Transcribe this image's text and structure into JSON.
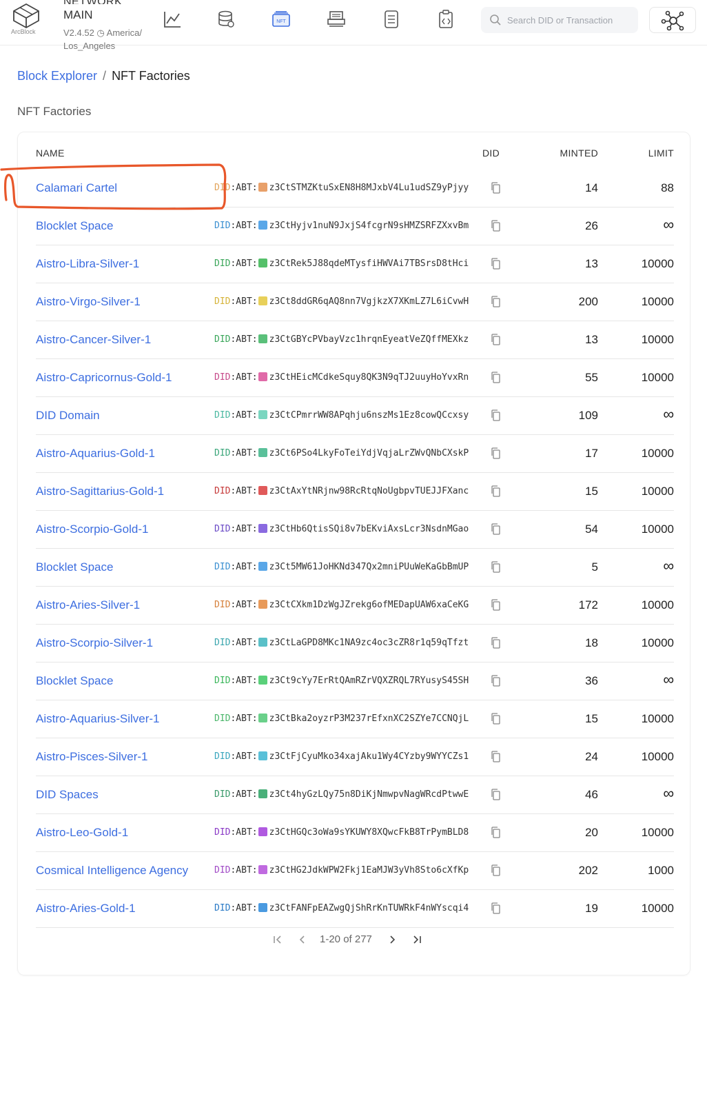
{
  "header": {
    "logo_text": "ArcBlock",
    "network_label": "NETWORK",
    "network_name": "MAIN",
    "version_tz": "V2.4.52 ◷ America/ Los_Angeles",
    "nav_icons": [
      "chart-icon",
      "database-icon",
      "nft-icon",
      "printer-icon",
      "document-icon",
      "contract-icon"
    ],
    "nft_icon_text": "NFT",
    "search_placeholder": "Search DID or Transaction"
  },
  "breadcrumb": {
    "root": "Block Explorer",
    "separator": "/",
    "current": "NFT Factories"
  },
  "page_title": "NFT Factories",
  "table": {
    "columns": {
      "name": "NAME",
      "did": "DID",
      "minted": "MINTED",
      "limit": "LIMIT"
    },
    "did_prefix_a": "DID",
    "did_prefix_b": ":ABT:",
    "rows": [
      {
        "name": "Calamari Cartel",
        "did": "z3CtSTMZKtuSxEN8H8MJxbV4Lu1udSZ9yPjyy",
        "minted": "14",
        "limit": "88",
        "color": "#e8a06a",
        "pfx": "#e2a35a"
      },
      {
        "name": "Blocklet Space",
        "did": "z3CtHyjv1nuN9JxjS4fcgrN9sHMZSRFZXxvBm",
        "minted": "26",
        "limit": "∞",
        "color": "#5aa7e8",
        "pfx": "#3a8fd1"
      },
      {
        "name": "Aistro-Libra-Silver-1",
        "did": "z3CtRek5J88qdeMTysfiHWVAi7TBSrsD8tHci",
        "minted": "13",
        "limit": "10000",
        "color": "#55c06a",
        "pfx": "#3aa65a"
      },
      {
        "name": "Aistro-Virgo-Silver-1",
        "did": "z3Ct8ddGR6qAQ8nn7VgjkzX7XKmLZ7L6iCvwH",
        "minted": "200",
        "limit": "10000",
        "color": "#e8d05a",
        "pfx": "#d6b43a"
      },
      {
        "name": "Aistro-Cancer-Silver-1",
        "did": "z3CtGBYcPVbayVzc1hrqnEyeatVeZQffMEXkz",
        "minted": "13",
        "limit": "10000",
        "color": "#5ac07a",
        "pfx": "#3aa65a"
      },
      {
        "name": "Aistro-Capricornus-Gold-1",
        "did": "z3CtHEicMCdkeSquy8QK3N9qTJ2uuyHoYvxRn",
        "minted": "55",
        "limit": "10000",
        "color": "#e06aa8",
        "pfx": "#c64a8a"
      },
      {
        "name": "DID Domain",
        "did": "z3CtCPmrrWW8APqhju6nszMs1Ez8cowQCcxsy",
        "minted": "109",
        "limit": "∞",
        "color": "#7ad6c0",
        "pfx": "#4ab8a0"
      },
      {
        "name": "Aistro-Aquarius-Gold-1",
        "did": "z3Ct6PSo4LkyFoTeiYdjVqjaLrZWvQNbCXskP",
        "minted": "17",
        "limit": "10000",
        "color": "#5ac09a",
        "pfx": "#3aa67a"
      },
      {
        "name": "Aistro-Sagittarius-Gold-1",
        "did": "z3CtAxYtNRjnw98RcRtqNoUgbpvTUEJJFXanc",
        "minted": "15",
        "limit": "10000",
        "color": "#e05a5a",
        "pfx": "#c63a3a"
      },
      {
        "name": "Aistro-Scorpio-Gold-1",
        "did": "z3CtHb6QtisSQi8v7bEKviAxsLcr3NsdnMGao",
        "minted": "54",
        "limit": "10000",
        "color": "#8a6ae0",
        "pfx": "#6a4ac6"
      },
      {
        "name": "Blocklet Space",
        "did": "z3Ct5MW61JoHKNd347Qx2mniPUuWeKaGbBmUP",
        "minted": "5",
        "limit": "∞",
        "color": "#5aa7e8",
        "pfx": "#3a8fd1"
      },
      {
        "name": "Aistro-Aries-Silver-1",
        "did": "z3CtCXkm1DzWgJZrekg6ofMEDapUAW6xaCeKG",
        "minted": "172",
        "limit": "10000",
        "color": "#e89a5a",
        "pfx": "#d6803a"
      },
      {
        "name": "Aistro-Scorpio-Silver-1",
        "did": "z3CtLaGPD8MKc1NA9zc4oc3cZR8r1q59qTfzt",
        "minted": "18",
        "limit": "10000",
        "color": "#5ac0c8",
        "pfx": "#3aa6ae"
      },
      {
        "name": "Blocklet Space",
        "did": "z3Ct9cYy7ErRtQAmRZrVQXZRQL7RYusyS45SH",
        "minted": "36",
        "limit": "∞",
        "color": "#5ad07a",
        "pfx": "#3ab65a"
      },
      {
        "name": "Aistro-Aquarius-Silver-1",
        "did": "z3CtBka2oyzrP3M237rEfxnXC2SZYe7CCNQjL",
        "minted": "15",
        "limit": "10000",
        "color": "#6ad08a",
        "pfx": "#4ab66a"
      },
      {
        "name": "Aistro-Pisces-Silver-1",
        "did": "z3CtFjCyuMko34xajAku1Wy4CYzby9WYYCZs1",
        "minted": "24",
        "limit": "10000",
        "color": "#5ac0d8",
        "pfx": "#3aa6be"
      },
      {
        "name": "DID Spaces",
        "did": "z3Ct4hyGzLQy75n8DiKjNmwpvNagWRcdPtwwE",
        "minted": "46",
        "limit": "∞",
        "color": "#4ab07a",
        "pfx": "#3a9a6a"
      },
      {
        "name": "Aistro-Leo-Gold-1",
        "did": "z3CtHGQc3oWa9sYKUWY8XQwcFkB8TrPymBLD8",
        "minted": "20",
        "limit": "10000",
        "color": "#b05ae0",
        "pfx": "#8a3ac6"
      },
      {
        "name": "Cosmical Intelligence Agency",
        "did": "z3CtHG2JdkWPW2Fkj1EaMJW3yVh8Sto6cXfKp",
        "minted": "202",
        "limit": "1000",
        "color": "#c06ae0",
        "pfx": "#a04ac6"
      },
      {
        "name": "Aistro-Aries-Gold-1",
        "did": "z3CtFANFpEAZwgQjShRrKnTUWRkF4nWYscqi4",
        "minted": "19",
        "limit": "10000",
        "color": "#4a9ae0",
        "pfx": "#2a7ac6"
      }
    ]
  },
  "pagination": {
    "label": "1-20 of 277"
  },
  "colors": {
    "link": "#3d6ee0",
    "annotation": "#e8572a"
  }
}
